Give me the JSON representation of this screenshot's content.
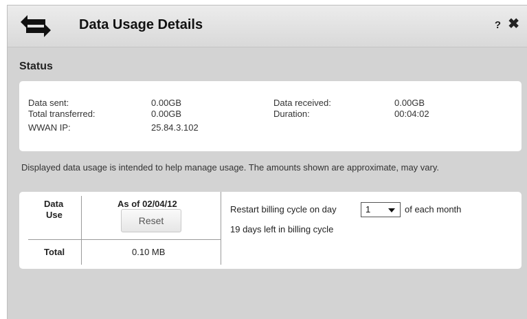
{
  "header": {
    "title": "Data Usage Details",
    "help_label": "?",
    "close_label": "✖",
    "icon": "transfer-arrows-icon"
  },
  "status": {
    "title": "Status",
    "data_sent_label": "Data sent:",
    "data_sent_value": "0.00GB",
    "total_transferred_label": "Total transferred:",
    "total_transferred_value": "0.00GB",
    "wwan_ip_label": "WWAN IP:",
    "wwan_ip_value": "25.84.3.102",
    "data_received_label": "Data received:",
    "data_received_value": "0.00GB",
    "duration_label": "Duration:",
    "duration_value": "00:04:02"
  },
  "note": "Displayed data usage is intended to help manage usage. The amounts shown are approximate, may vary.",
  "usage": {
    "data_use_label_1": "Data",
    "data_use_label_2": "Use",
    "as_of_label": "As of 02/04/12",
    "reset_label": "Reset",
    "total_label": "Total",
    "total_value": "0.10 MB",
    "billing_prefix": "Restart billing cycle on day",
    "billing_day": "1",
    "billing_suffix": "of each month",
    "days_left": "19 days left in billing cycle"
  },
  "colors": {
    "background": "#d3d3d3",
    "panel": "#ffffff",
    "header_gradient_top": "#ececec"
  }
}
